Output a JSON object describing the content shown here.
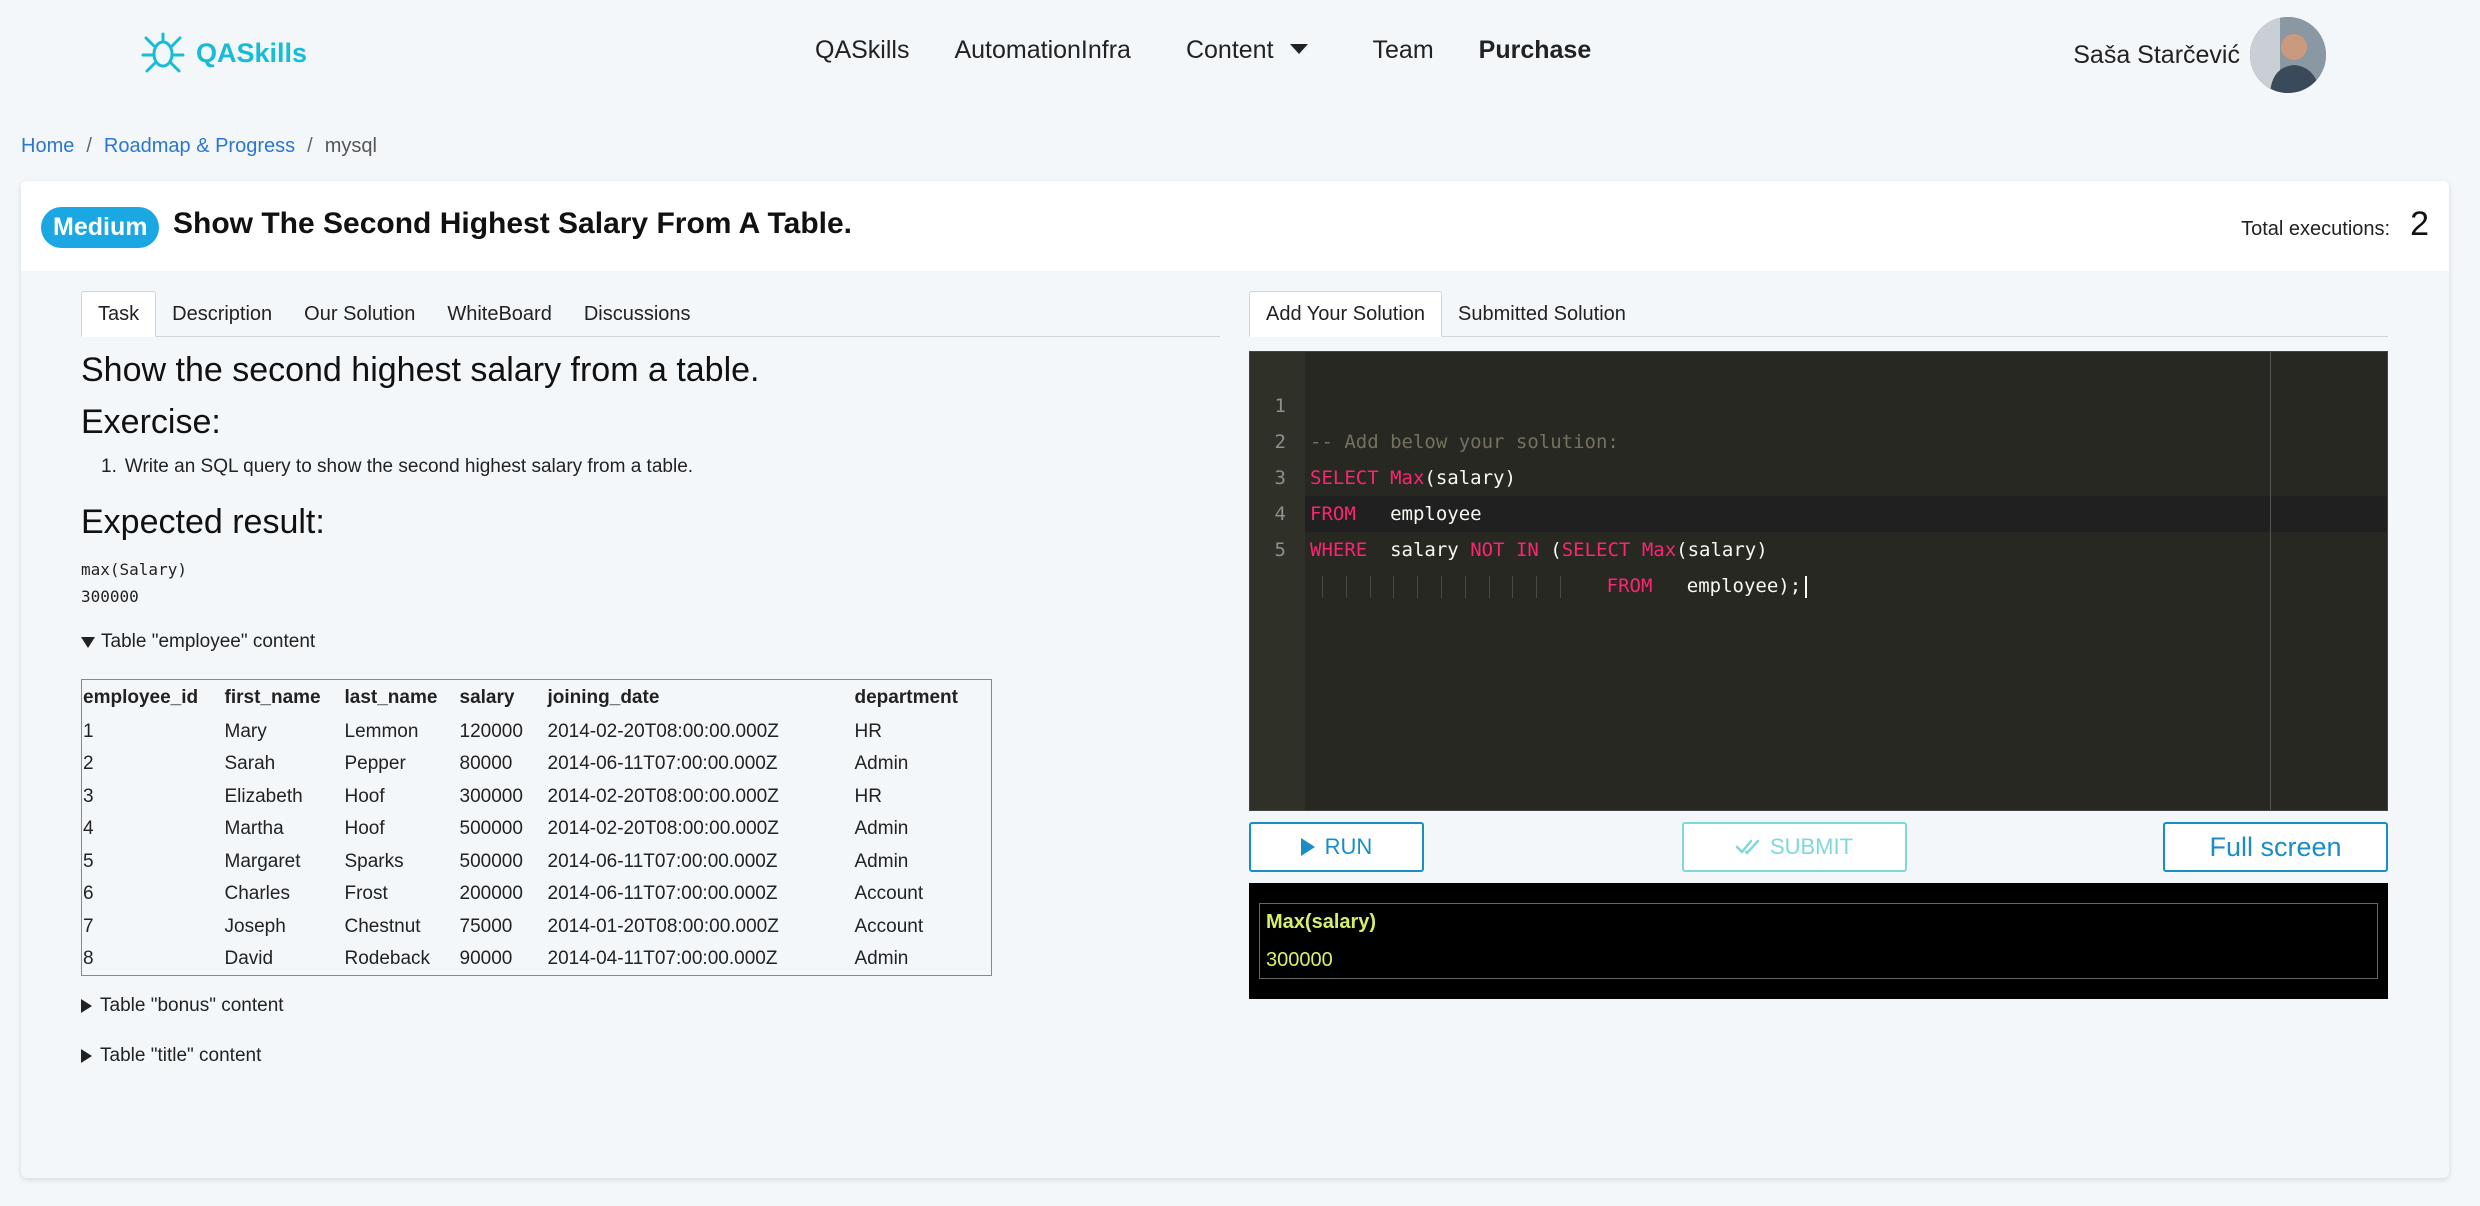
{
  "brand": {
    "name": "QASkills"
  },
  "nav": {
    "items": [
      "QASkills",
      "AutomationInfra",
      "Content",
      "Team",
      "Purchase"
    ]
  },
  "user": {
    "name": "Saša Starčević"
  },
  "breadcrumb": {
    "home": "Home",
    "roadmap": "Roadmap & Progress",
    "current": "mysql"
  },
  "task": {
    "difficulty": "Medium",
    "title": "Show The Second Highest Salary From A Table.",
    "executions_label": "Total executions:",
    "executions_value": "2"
  },
  "left_tabs": [
    "Task",
    "Description",
    "Our Solution",
    "WhiteBoard",
    "Discussions"
  ],
  "right_tabs": [
    "Add Your Solution",
    "Submitted Solution"
  ],
  "content": {
    "heading": "Show the second highest salary from a table.",
    "exercise_heading": "Exercise:",
    "exercise_num": "1.",
    "exercise_item": "Write an SQL query to show the second highest salary from a table.",
    "expected_heading": "Expected result:",
    "expected_lines": [
      "max(Salary)",
      "300000"
    ],
    "toggle_employee": "Table \"employee\" content",
    "toggle_bonus": "Table \"bonus\" content",
    "toggle_title": "Table \"title\" content"
  },
  "employee_table": {
    "columns": [
      "employee_id",
      "first_name",
      "last_name",
      "salary",
      "joining_date",
      "department"
    ],
    "rows": [
      [
        "1",
        "Mary",
        "Lemmon",
        "120000",
        "2014-02-20T08:00:00.000Z",
        "HR"
      ],
      [
        "2",
        "Sarah",
        "Pepper",
        "80000",
        "2014-06-11T07:00:00.000Z",
        "Admin"
      ],
      [
        "3",
        "Elizabeth",
        "Hoof",
        "300000",
        "2014-02-20T08:00:00.000Z",
        "HR"
      ],
      [
        "4",
        "Martha",
        "Hoof",
        "500000",
        "2014-02-20T08:00:00.000Z",
        "Admin"
      ],
      [
        "5",
        "Margaret",
        "Sparks",
        "500000",
        "2014-06-11T07:00:00.000Z",
        "Admin"
      ],
      [
        "6",
        "Charles",
        "Frost",
        "200000",
        "2014-06-11T07:00:00.000Z",
        "Account"
      ],
      [
        "7",
        "Joseph",
        "Chestnut",
        "75000",
        "2014-01-20T08:00:00.000Z",
        "Account"
      ],
      [
        "8",
        "David",
        "Rodeback",
        "90000",
        "2014-04-11T07:00:00.000Z",
        "Admin"
      ]
    ]
  },
  "editor": {
    "line_numbers": [
      "1",
      "2",
      "3",
      "4",
      "5"
    ],
    "l1_comment": "-- Add below your solution:",
    "l2_kw1": "SELECT",
    "l2_kw2": "Max",
    "l2_rest": "(salary)",
    "l3_kw": "FROM",
    "l3_rest": "employee",
    "l4_kw1": "WHERE",
    "l4_t1": "salary",
    "l4_kw2": "NOT IN",
    "l4_t2": "(",
    "l4_kw3": "SELECT",
    "l4_kw4": "Max",
    "l4_t3": "(salary)",
    "l5_kw": "FROM",
    "l5_rest": "employee);"
  },
  "buttons": {
    "run": "RUN",
    "submit": "SUBMIT",
    "fullscreen": "Full screen"
  },
  "result": {
    "header": "Max(salary)",
    "value": "300000"
  },
  "colors": {
    "brand": "#17bcd6",
    "badge": "#1aa7e2",
    "link": "#2a76d2",
    "keyword": "#f92672",
    "result_text": "#d4f06a"
  }
}
